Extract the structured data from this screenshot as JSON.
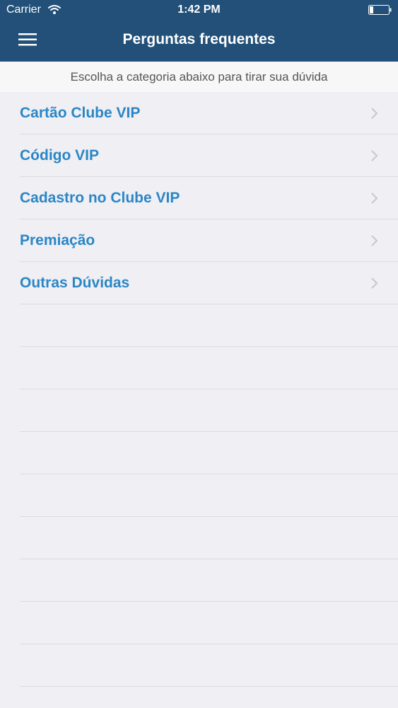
{
  "status_bar": {
    "carrier": "Carrier",
    "time": "1:42 PM",
    "wifi_icon": "wifi-icon",
    "battery_icon": "battery-icon"
  },
  "nav": {
    "menu_icon": "hamburger-menu-icon",
    "title": "Perguntas frequentes"
  },
  "subtitle": "Escolha a categoria abaixo para tirar sua dúvida",
  "categories": [
    {
      "label": "Cartão Clube VIP"
    },
    {
      "label": "Código VIP"
    },
    {
      "label": "Cadastro no Clube VIP"
    },
    {
      "label": "Premiação"
    },
    {
      "label": "Outras Dúvidas"
    }
  ],
  "icons": {
    "row_chevron": "chevron-right-icon"
  },
  "colors": {
    "nav_background": "#225078",
    "link_blue": "#2b86c6",
    "page_background": "#efeff4",
    "subtitle_background": "#f7f7f7",
    "separator": "#dcdce0",
    "chevron": "#c7c7cc"
  }
}
